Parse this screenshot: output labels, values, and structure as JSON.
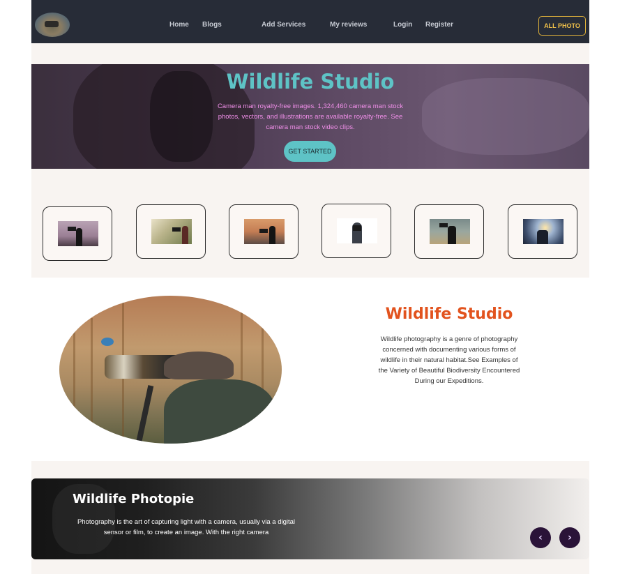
{
  "nav": {
    "links": [
      "Home",
      "Blogs",
      "Add Services",
      "My reviews",
      "Login",
      "Register"
    ],
    "all_photo_label": "ALL PHOTO"
  },
  "hero": {
    "title": "Wildlife Studio",
    "text": "Camera man royalty-free images. 1,324,460 camera man stock photos, vectors, and illustrations are available royalty-free. See camera man stock video clips.",
    "button_label": "GET STARTED"
  },
  "about": {
    "title": "Wildlife Studio",
    "text": "Wildlife photography is a genre of photography concerned with documenting various forms of wildlife in their natural habitat.See Examples of the Variety of Beautiful Biodiversity Encountered During our Expeditions."
  },
  "banner": {
    "title": "Wildlife Photopie",
    "text": "Photography is the art of capturing light with a camera, usually via a digital sensor or film, to create an image. With the right camera",
    "prev_icon": "chevron-left-icon",
    "next_icon": "chevron-right-icon"
  },
  "colors": {
    "nav_bg": "#272c37",
    "accent_teal": "#5ec3c6",
    "hero_text_pink": "#f08fe9",
    "about_title_orange": "#e2531e",
    "button_gold": "#f2c24a",
    "round_button": "#2a1338"
  }
}
